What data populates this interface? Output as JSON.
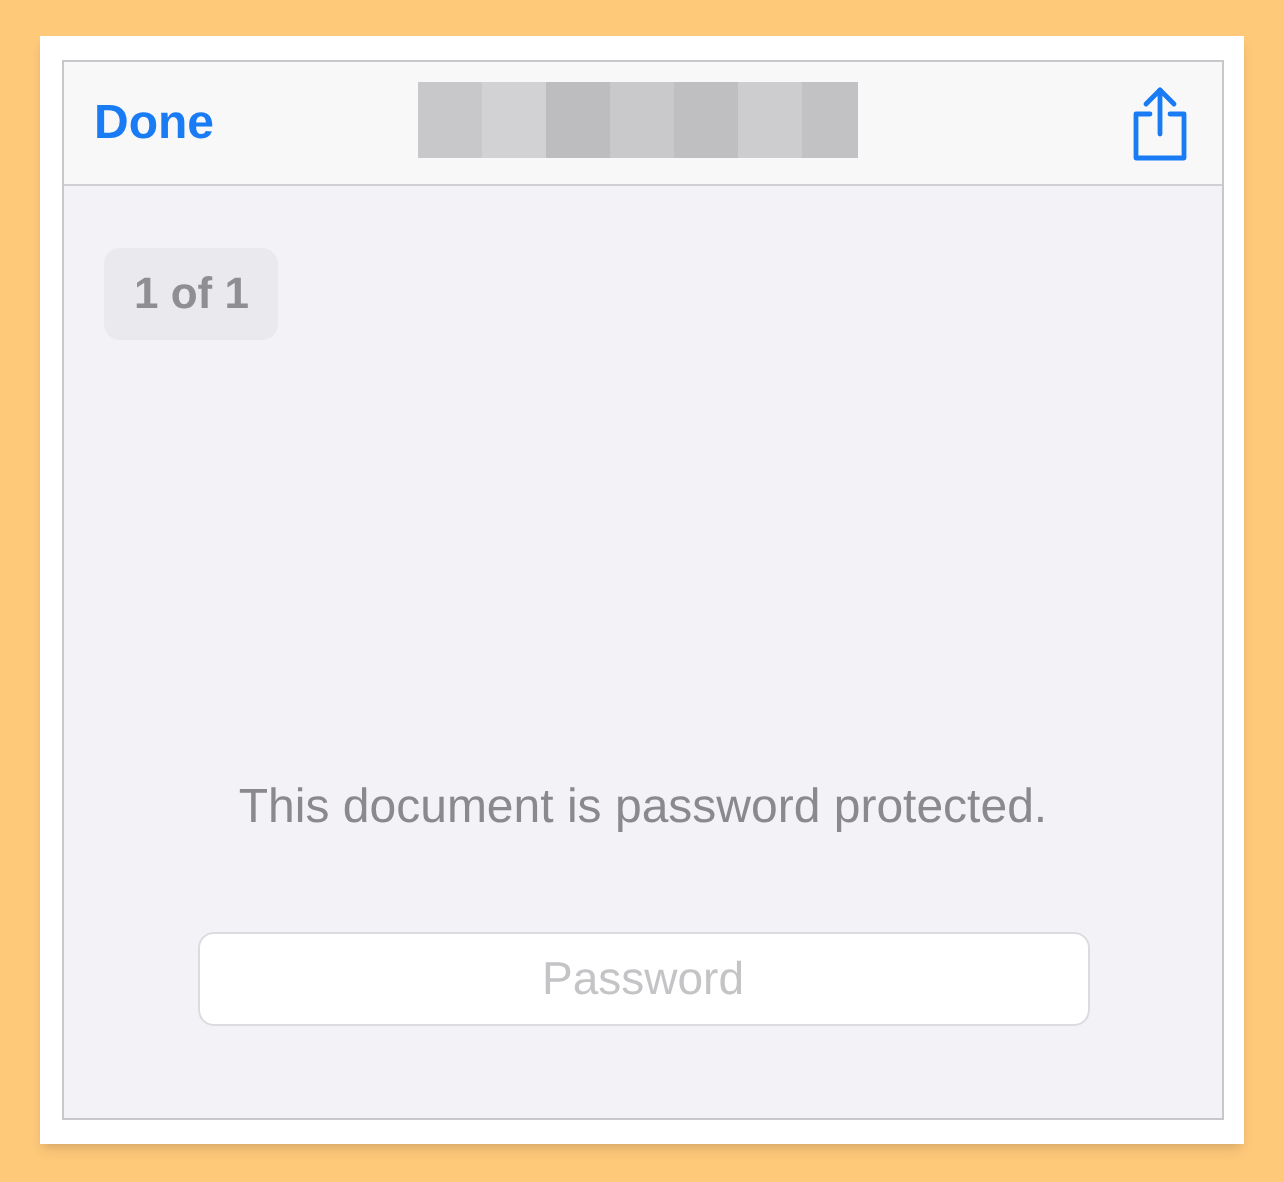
{
  "nav_bar": {
    "done_button": "Done"
  },
  "page_indicator": "1 of 1",
  "message": "This document is password protected.",
  "password_field": {
    "placeholder": "Password"
  }
}
